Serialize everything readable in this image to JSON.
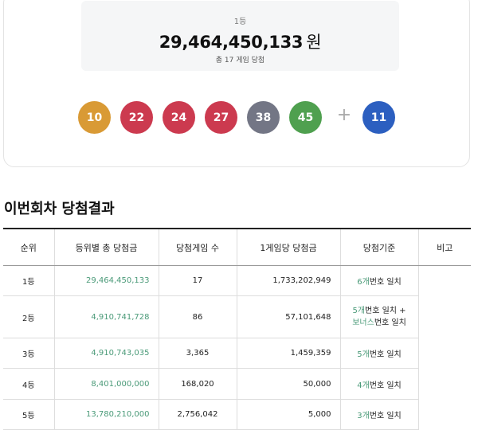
{
  "prize": {
    "rank": "1등",
    "amount": "29,464,450,133",
    "unit": "원",
    "games": "총 17 게임 당첨"
  },
  "balls": [
    {
      "num": "10",
      "color": "#d99a35"
    },
    {
      "num": "22",
      "color": "#cc3a4f"
    },
    {
      "num": "24",
      "color": "#cc3a4f"
    },
    {
      "num": "27",
      "color": "#cc3a4f"
    },
    {
      "num": "38",
      "color": "#737685"
    },
    {
      "num": "45",
      "color": "#4fa04f"
    }
  ],
  "plus_symbol": "+",
  "bonus_ball": {
    "num": "11",
    "color": "#2c5fc0"
  },
  "section_title": "이번회차 당첨결과",
  "table": {
    "headers": [
      "순위",
      "등위별 총 당첨금",
      "당첨게임 수",
      "1게임당 당첨금",
      "당첨기준",
      "비고"
    ],
    "rows": [
      {
        "rank": "1등",
        "total": "29,464,450,133",
        "games": "17",
        "per_game": "1,733,202,949",
        "crit": {
          "count": "6개",
          "text": "번호 일치"
        }
      },
      {
        "rank": "2등",
        "total": "4,910,741,728",
        "games": "86",
        "per_game": "57,101,648",
        "crit": {
          "count": "5개",
          "text": "번호 일치 +",
          "bonus": "보너스",
          "bonus_text": "번호 일치"
        }
      },
      {
        "rank": "3등",
        "total": "4,910,743,035",
        "games": "3,365",
        "per_game": "1,459,359",
        "crit": {
          "count": "5개",
          "text": "번호 일치"
        }
      },
      {
        "rank": "4등",
        "total": "8,401,000,000",
        "games": "168,020",
        "per_game": "50,000",
        "crit": {
          "count": "4개",
          "text": "번호 일치"
        }
      },
      {
        "rank": "5등",
        "total": "13,780,210,000",
        "games": "2,756,042",
        "per_game": "5,000",
        "crit": {
          "count": "3개",
          "text": "번호 일치"
        }
      }
    ]
  }
}
